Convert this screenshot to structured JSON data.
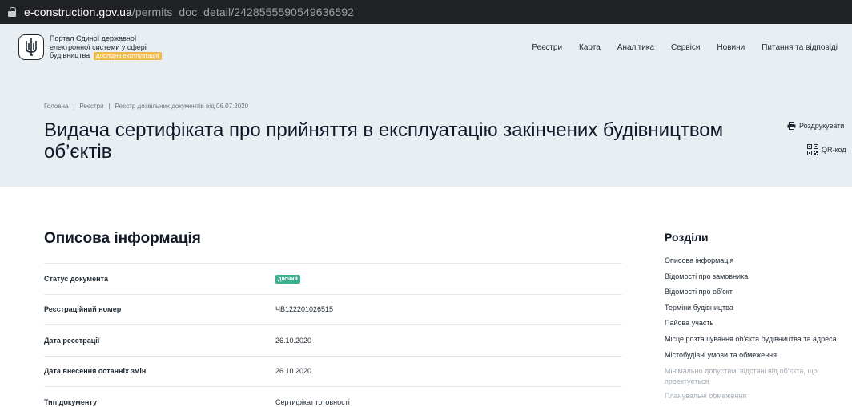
{
  "browser": {
    "url_host": "e-construction.gov.ua",
    "url_path": "/permits_doc_detail/2428555590549636592"
  },
  "header": {
    "portal_name": "Портал Єдиної державної електронної системи у сфері будівництва",
    "beta_badge": "Дослідна експлуатація",
    "nav": [
      "Реєстри",
      "Карта",
      "Аналітика",
      "Сервіси",
      "Новини",
      "Питання та відповіді"
    ]
  },
  "breadcrumb": [
    "Головна",
    "Реєстри",
    "Реєстр дозвільних документів від 06.07.2020"
  ],
  "page_title": "Видача сертифіката про прийняття в експлуатацію закінчених будівництвом об’єктів",
  "actions": {
    "print": "Роздрукувати",
    "qr": "QR-код"
  },
  "main": {
    "section_title": "Описова інформація",
    "rows": [
      {
        "label": "Статус документа",
        "value": "діючий",
        "badge": true
      },
      {
        "label": "Реєстраційний номер",
        "value": "ЧВ122201026515"
      },
      {
        "label": "Дата реєстрації",
        "value": "26.10.2020"
      },
      {
        "label": "Дата внесення останніх змін",
        "value": "26.10.2020"
      },
      {
        "label": "Тип документу",
        "value": "Сертифікат готовності"
      }
    ]
  },
  "sections": {
    "title": "Розділи",
    "items": [
      {
        "label": "Описова інформація"
      },
      {
        "label": "Відомості про замовника"
      },
      {
        "label": "Відомості про об’єкт"
      },
      {
        "label": "Терміни будівництва"
      },
      {
        "label": "Пайова участь"
      },
      {
        "label": "Місце розташування об’єкта будівництва та адреса"
      },
      {
        "label": "Містобудівні умови та обмеження"
      },
      {
        "label": "Мінімально допустимі відстані від об’єкта, що проектується",
        "muted": true
      },
      {
        "label": "Планувальні обмеження",
        "muted": true
      }
    ]
  },
  "colors": {
    "hero_bg": "#e9eef3",
    "status_green": "#3bb08f",
    "beta_orange": "#f0b849"
  }
}
